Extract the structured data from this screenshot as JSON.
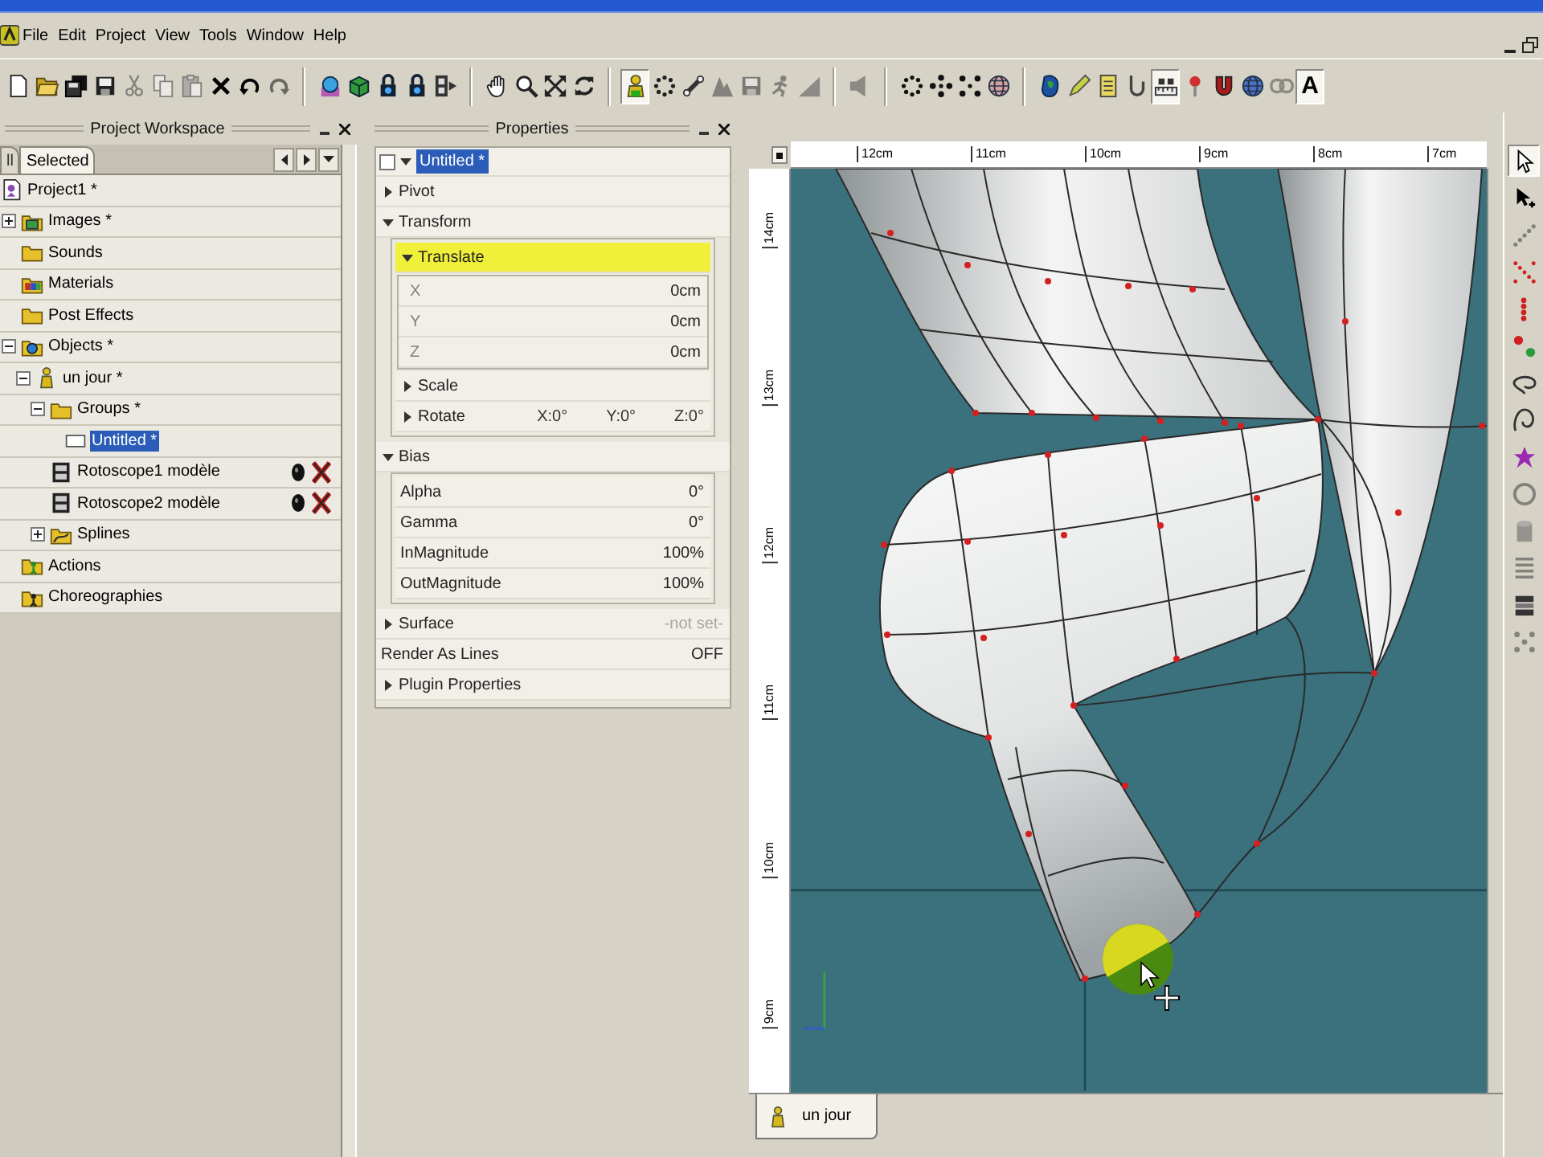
{
  "menu": [
    "File",
    "Edit",
    "Project",
    "View",
    "Tools",
    "Window",
    "Help"
  ],
  "toolbar": [
    {
      "items": [
        {
          "disabled": false,
          "pressed": false
        },
        {
          "disabled": false,
          "pressed": false
        },
        {
          "disabled": false,
          "pressed": false
        },
        {
          "disabled": false,
          "pressed": false
        },
        {
          "disabled": true,
          "pressed": false
        },
        {
          "disabled": true,
          "pressed": false
        },
        {
          "disabled": true,
          "pressed": false
        },
        {
          "disabled": false,
          "pressed": false
        },
        {
          "disabled": false,
          "pressed": false
        },
        {
          "disabled": true,
          "pressed": false
        }
      ]
    },
    {
      "items": [
        {
          "disabled": false,
          "pressed": false
        },
        {
          "disabled": false,
          "pressed": false
        },
        {
          "disabled": false,
          "pressed": false
        },
        {
          "disabled": false,
          "pressed": false
        },
        {
          "disabled": false,
          "pressed": false
        }
      ]
    },
    {
      "items": [
        {
          "disabled": false,
          "pressed": false
        },
        {
          "disabled": false,
          "pressed": false
        },
        {
          "disabled": false,
          "pressed": false
        },
        {
          "disabled": false,
          "pressed": false
        }
      ]
    },
    {
      "items": [
        {
          "disabled": false,
          "pressed": true
        },
        {
          "disabled": false,
          "pressed": false
        },
        {
          "disabled": false,
          "pressed": false
        },
        {
          "disabled": true,
          "pressed": false
        },
        {
          "disabled": true,
          "pressed": false
        },
        {
          "disabled": true,
          "pressed": false
        },
        {
          "disabled": true,
          "pressed": false
        }
      ]
    },
    {
      "items": [
        {
          "disabled": true,
          "pressed": false
        }
      ]
    },
    {
      "items": [
        {
          "disabled": false,
          "pressed": false
        },
        {
          "disabled": false,
          "pressed": false
        },
        {
          "disabled": false,
          "pressed": false
        },
        {
          "disabled": false,
          "pressed": false
        }
      ]
    },
    {
      "items": [
        {
          "disabled": false,
          "pressed": false
        },
        {
          "disabled": false,
          "pressed": false
        },
        {
          "disabled": false,
          "pressed": false
        },
        {
          "disabled": false,
          "pressed": false
        },
        {
          "disabled": false,
          "pressed": true
        },
        {
          "disabled": false,
          "pressed": false
        },
        {
          "disabled": false,
          "pressed": false
        },
        {
          "disabled": false,
          "pressed": false
        },
        {
          "disabled": true,
          "pressed": false
        },
        {
          "disabled": false,
          "pressed": true,
          "label": "A"
        }
      ]
    }
  ],
  "workspace": {
    "title": "Project Workspace",
    "tabs": [
      {
        "label": "ll",
        "selected": false
      },
      {
        "label": "Selected",
        "selected": true
      }
    ],
    "tree": [
      {
        "label": "Project1 *",
        "kind": "project",
        "selected": false,
        "children": [
          {
            "label": "Images *",
            "kind": "images",
            "selected": false,
            "expanded": false
          },
          {
            "label": "Sounds",
            "kind": "sounds",
            "selected": false
          },
          {
            "label": "Materials",
            "kind": "materials",
            "selected": false
          },
          {
            "label": "Post Effects",
            "kind": "effects",
            "selected": false
          },
          {
            "label": "Objects *",
            "kind": "objects",
            "selected": false,
            "expanded": true,
            "children": [
              {
                "label": "un jour *",
                "kind": "model",
                "selected": false,
                "expanded": true,
                "children": [
                  {
                    "label": "Groups *",
                    "kind": "groups",
                    "selected": false,
                    "expanded": true,
                    "children": [
                      {
                        "label": "Untitled *",
                        "kind": "group",
                        "selected": true
                      }
                    ]
                  },
                  {
                    "label": "Rotoscope1 modèle",
                    "kind": "rotoscope",
                    "selected": false
                  },
                  {
                    "label": "Rotoscope2 modèle",
                    "kind": "rotoscope",
                    "selected": false
                  },
                  {
                    "label": "Splines",
                    "kind": "splines",
                    "selected": false,
                    "expanded": false
                  }
                ]
              }
            ]
          },
          {
            "label": "Actions",
            "kind": "actions",
            "selected": false
          },
          {
            "label": "Choreographies",
            "kind": "choreographies",
            "selected": false
          }
        ]
      }
    ]
  },
  "properties": {
    "title": "Properties",
    "object": {
      "label": "Untitled *",
      "checked": false,
      "expanded": true,
      "selected": true
    },
    "items": [
      {
        "kind": "section",
        "label": "Pivot",
        "expanded": false,
        "selected": false
      },
      {
        "kind": "section",
        "label": "Transform",
        "expanded": true,
        "selected": false,
        "children": [
          {
            "kind": "section",
            "label": "Translate",
            "expanded": true,
            "selected": true,
            "children": [
              {
                "kind": "value",
                "label": "X",
                "value": "0cm"
              },
              {
                "kind": "value",
                "label": "Y",
                "value": "0cm"
              },
              {
                "kind": "value",
                "label": "Z",
                "value": "0cm"
              }
            ]
          },
          {
            "kind": "section",
            "label": "Scale",
            "expanded": false,
            "selected": false
          },
          {
            "kind": "section",
            "label": "Rotate",
            "expanded": false,
            "selected": false,
            "values": [
              "X:0°",
              "Y:0°",
              "Z:0°"
            ]
          }
        ]
      },
      {
        "kind": "section",
        "label": "Bias",
        "expanded": true,
        "selected": false,
        "children": [
          {
            "kind": "value",
            "label": "Alpha",
            "value": "0°"
          },
          {
            "kind": "value",
            "label": "Gamma",
            "value": "0°"
          },
          {
            "kind": "value",
            "label": "InMagnitude",
            "value": "100%"
          },
          {
            "kind": "value",
            "label": "OutMagnitude",
            "value": "100%"
          }
        ]
      },
      {
        "kind": "section",
        "label": "Surface",
        "expanded": false,
        "selected": false,
        "value": "-not set-"
      },
      {
        "kind": "value",
        "label": "Render As Lines",
        "value": "OFF"
      },
      {
        "kind": "section",
        "label": "Plugin Properties",
        "expanded": false,
        "selected": false
      }
    ]
  },
  "viewport": {
    "ruler_top": [
      "12cm",
      "11cm",
      "10cm",
      "9cm",
      "8cm",
      "7cm"
    ],
    "ruler_left": [
      "14cm",
      "13cm",
      "12cm",
      "11cm",
      "10cm",
      "9cm"
    ],
    "tabs": [
      {
        "label": "un jour",
        "selected": true
      }
    ]
  },
  "side_toolbar": [
    {
      "disabled": false,
      "pressed": true
    },
    {
      "disabled": false,
      "pressed": false
    },
    {
      "disabled": true,
      "pressed": false
    },
    {
      "disabled": false,
      "pressed": false
    },
    {
      "disabled": false,
      "pressed": false
    },
    {
      "disabled": false,
      "pressed": false
    },
    {
      "disabled": false,
      "pressed": false
    },
    {
      "disabled": false,
      "pressed": false
    },
    {
      "disabled": false,
      "pressed": false
    },
    {
      "disabled": true,
      "pressed": false
    },
    {
      "disabled": true,
      "pressed": false
    },
    {
      "disabled": true,
      "pressed": false
    },
    {
      "disabled": false,
      "pressed": false
    },
    {
      "disabled": true,
      "pressed": false
    }
  ]
}
